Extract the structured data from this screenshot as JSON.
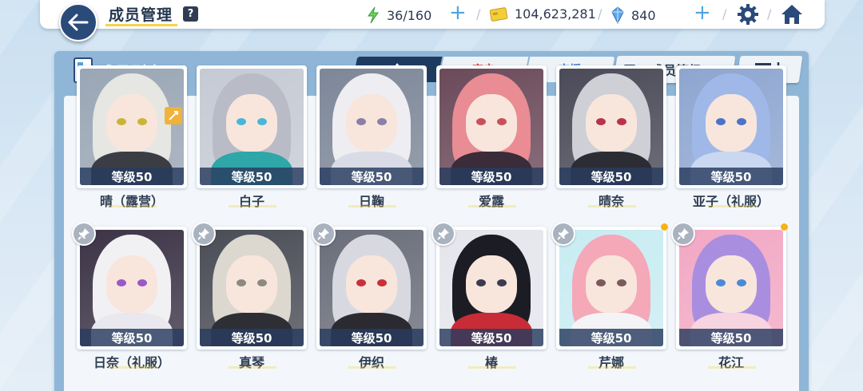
{
  "header": {
    "title": "成员管理",
    "help_label": "?",
    "stamina": "36/160",
    "credits": "104,623,281",
    "gems": "840",
    "colors": {
      "accent": "#4fa3e0",
      "nav": "#2a4a7a",
      "underline": "#f4d44a"
    }
  },
  "panel": {
    "title": "成员列表",
    "tabs": [
      {
        "label": "全",
        "selected": true
      },
      {
        "label": "突击",
        "selected": false
      },
      {
        "label": "支援",
        "selected": false
      }
    ],
    "sort_label": "成员等级"
  },
  "members": [
    {
      "level": "等级50",
      "name": "晴（露营）",
      "hair": "#e6e6e2",
      "eye": "#c9b43a",
      "body": "#3a3d44",
      "bg": "#9aa6b5"
    },
    {
      "level": "等级50",
      "name": "白子",
      "hair": "#b9bcc6",
      "eye": "#49b6d8",
      "body": "#2fa6a8",
      "bg": "#c5cad4"
    },
    {
      "level": "等级50",
      "name": "日鞠",
      "hair": "#eeeef2",
      "eye": "#8a7fa8",
      "body": "#d9dce6",
      "bg": "#7d8798"
    },
    {
      "level": "等级50",
      "name": "爱露",
      "hair": "#e98c94",
      "eye": "#c7515a",
      "body": "#3a2c38",
      "bg": "#6b4a5a"
    },
    {
      "level": "等级50",
      "name": "晴奈",
      "hair": "#cfcfd6",
      "eye": "#b8344a",
      "body": "#2c2c34",
      "bg": "#4a4a58"
    },
    {
      "level": "等级50",
      "name": "亚子（礼服）",
      "hair": "#9fb8e8",
      "eye": "#4a73c9",
      "body": "#c9d8f0",
      "bg": "#8ea6d0"
    },
    {
      "level": "等级50",
      "name": "日奈（礼服）",
      "hair": "#f1f1f4",
      "eye": "#9a58c8",
      "body": "#e8e8ee",
      "bg": "#3c3446"
    },
    {
      "level": "等级50",
      "name": "真琴",
      "hair": "#dcd8d0",
      "eye": "#8c8a80",
      "body": "#2e2f34",
      "bg": "#4a4d56"
    },
    {
      "level": "等级50",
      "name": "伊织",
      "hair": "#d8d9e0",
      "eye": "#c9303a",
      "body": "#2a2a30",
      "bg": "#6a6e7a"
    },
    {
      "level": "等级50",
      "name": "椿",
      "hair": "#1c1c24",
      "eye": "#3a3a52",
      "body": "#c82c36",
      "bg": "#e4e6ec"
    },
    {
      "level": "等级50",
      "name": "芹娜",
      "hair": "#f4a8b8",
      "eye": "#7a5a5c",
      "body": "#f4f4f6",
      "bg": "#c8ecf2"
    },
    {
      "level": "等级50",
      "name": "花江",
      "hair": "#a98ee0",
      "eye": "#4a8ad8",
      "body": "#f6d4e0",
      "bg": "#f2a8c4"
    }
  ]
}
